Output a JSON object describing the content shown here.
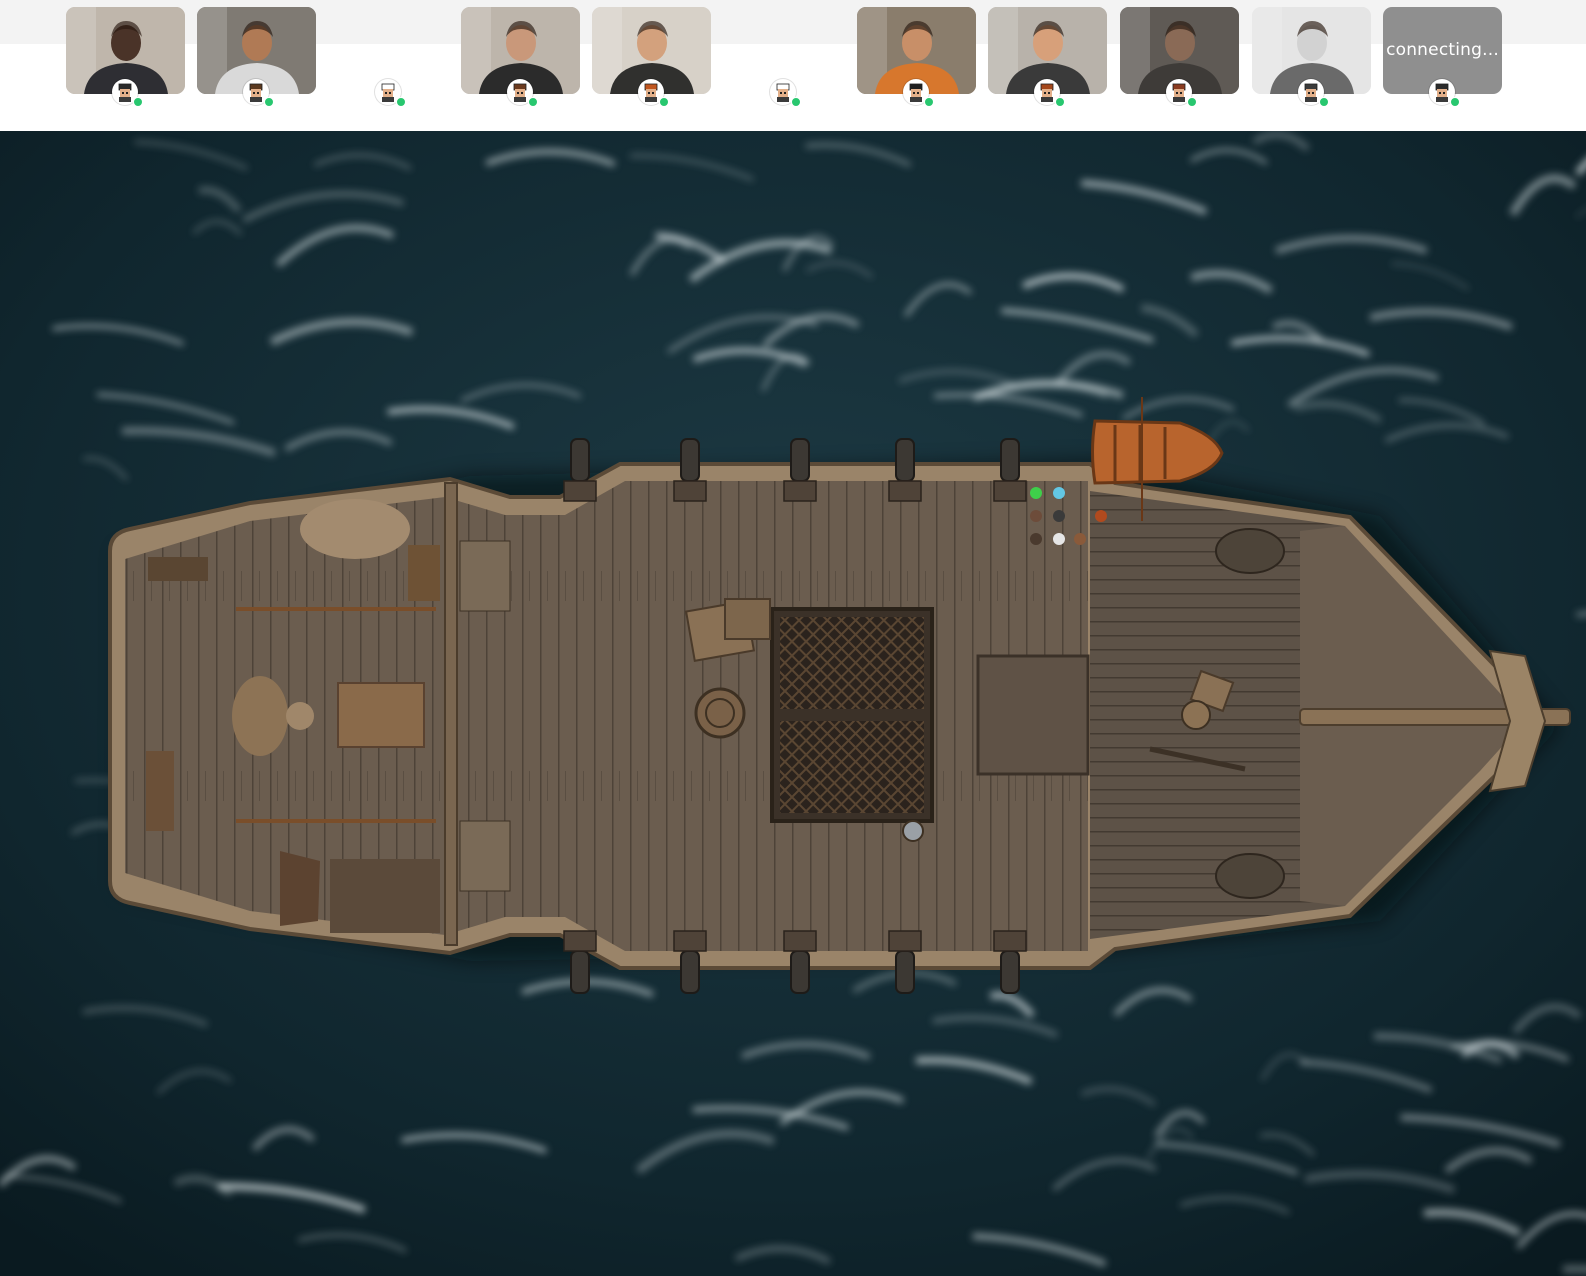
{
  "participants": [
    {
      "id": "p1",
      "type": "video",
      "skin": "#4a3328",
      "shirt": "#2e2e33",
      "bg": "#bfb6ab",
      "avatar_hair": "#2b2b2b",
      "status_color": "#28c76f"
    },
    {
      "id": "p2",
      "type": "video",
      "skin": "#b07a55",
      "shirt": "#d9d9d9",
      "bg": "#7f7a73",
      "avatar_hair": "#5b3a20",
      "status_color": "#28c76f"
    },
    {
      "id": "p3",
      "type": "empty",
      "avatar_hair": "#ffffff",
      "status_color": "#28c76f"
    },
    {
      "id": "p4",
      "type": "video",
      "skin": "#c9987a",
      "shirt": "#2b2b2b",
      "bg": "#bdb5ab",
      "avatar_hair": "#6b3a1e",
      "status_color": "#28c76f"
    },
    {
      "id": "p5",
      "type": "video",
      "skin": "#d3a17d",
      "shirt": "#30302e",
      "bg": "#d7d1c8",
      "avatar_hair": "#c0561f",
      "status_color": "#28c76f"
    },
    {
      "id": "p6",
      "type": "empty",
      "avatar_hair": "#ffffff",
      "status_color": "#28c76f"
    },
    {
      "id": "p7",
      "type": "video",
      "skin": "#c88f68",
      "shirt": "#d7772d",
      "bg": "#8a7d6c",
      "avatar_hair": "#1f1f1f",
      "status_color": "#28c76f"
    },
    {
      "id": "p8",
      "type": "video",
      "skin": "#d7a07a",
      "shirt": "#3a3a3a",
      "bg": "#b8b2aa",
      "avatar_hair": "#a4471b",
      "status_color": "#28c76f"
    },
    {
      "id": "p9",
      "type": "video",
      "skin": "#8a6a56",
      "shirt": "#3e3b38",
      "bg": "#5f5a55",
      "avatar_hair": "#8a3b20",
      "status_color": "#28c76f"
    },
    {
      "id": "p10",
      "type": "video",
      "skin": "#d2d2d2",
      "shirt": "#6a6a6a",
      "bg": "#e5e5e5",
      "avatar_hair": "#3a3a3a",
      "status_color": "#28c76f"
    },
    {
      "id": "p11",
      "type": "connecting",
      "label": "connecting...",
      "avatar_hair": "#2b2b2b",
      "status_color": "#28c76f"
    }
  ],
  "colors": {
    "topbar_bg": "#ffffff",
    "strip_bg": "#f3f3f3",
    "online": "#28c76f",
    "sea_deep": "#0f2730",
    "foam": "#dfe8ea",
    "deck": "#6f6253",
    "hull": "#9a8469",
    "rowboat": "#b8642d"
  },
  "map_icons": [
    "ship-map-icon",
    "rowboat-icon",
    "cargo-hatch-icon",
    "cannon-icon",
    "barrel-icon",
    "crate-icon",
    "rug-icon",
    "bed-icon"
  ]
}
